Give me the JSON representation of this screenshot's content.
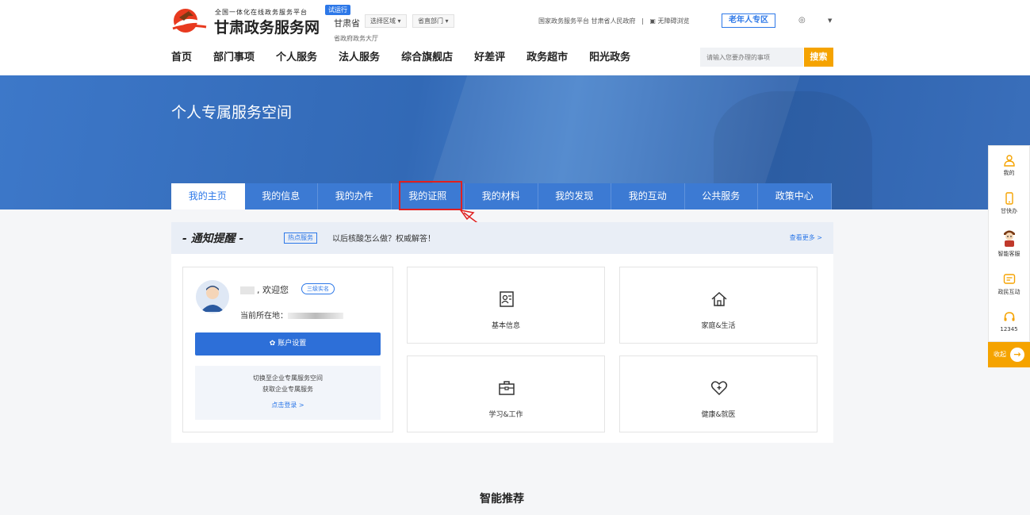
{
  "header": {
    "logo_subtitle": "全国一体化在线政务服务平台",
    "trial_badge": "试运行",
    "site_title": "甘肃政务服务网",
    "province": "甘肃省",
    "region_select": "选择区域",
    "dept_select": "省直部门",
    "hall": "省政府政务大厅",
    "link_national": "国家政务服务平台",
    "link_gov": "甘肃省人民政府",
    "separator": "|",
    "link_accessible": "无障碍浏览",
    "elder_zone": "老年人专区",
    "user_icon": "◎",
    "dropdown_caret": "▼"
  },
  "main_nav": [
    "首页",
    "部门事项",
    "个人服务",
    "法人服务",
    "综合旗舰店",
    "好差评",
    "政务超市",
    "阳光政务"
  ],
  "search": {
    "placeholder": "请输入您要办理的事项",
    "button": "搜索"
  },
  "banner": {
    "title": "个人专属服务空间"
  },
  "tabs": [
    "我的主页",
    "我的信息",
    "我的办件",
    "我的证照",
    "我的材料",
    "我的发现",
    "我的互动",
    "公共服务",
    "政策中心"
  ],
  "notice": {
    "title": "- 通知提醒 -",
    "tag": "热点服务",
    "text": "以后核酸怎么做？权威解答！",
    "more": "查看更多 >"
  },
  "user_card": {
    "welcome": ", 欢迎您",
    "level": "三级实名",
    "location_label": "当前所在地：",
    "settings_button": "账户设置",
    "switch_line1": "切换至企业专属服务空间",
    "switch_line2": "获取企业专属服务",
    "switch_login": "点击登录 >"
  },
  "services": [
    {
      "label": "基本信息",
      "icon": "id-card-icon"
    },
    {
      "label": "家庭&生活",
      "icon": "home-icon"
    },
    {
      "label": "学习&工作",
      "icon": "briefcase-icon"
    },
    {
      "label": "健康&就医",
      "icon": "health-heart-icon"
    }
  ],
  "recommend_title": "智能推荐",
  "right_sidebar": {
    "items": [
      {
        "label": "我的",
        "icon": "user-icon"
      },
      {
        "label": "甘快办",
        "icon": "mobile-icon"
      },
      {
        "label": "智能客服",
        "icon": "robot-icon"
      },
      {
        "label": "政民互动",
        "icon": "message-icon"
      },
      {
        "label": "12345",
        "icon": "headset-icon"
      }
    ],
    "collapse_label": "收起",
    "collapse_arrow": "→"
  },
  "colors": {
    "brand_blue": "#2d78e8",
    "accent_orange": "#f5a300",
    "highlight_red": "#e02020"
  }
}
